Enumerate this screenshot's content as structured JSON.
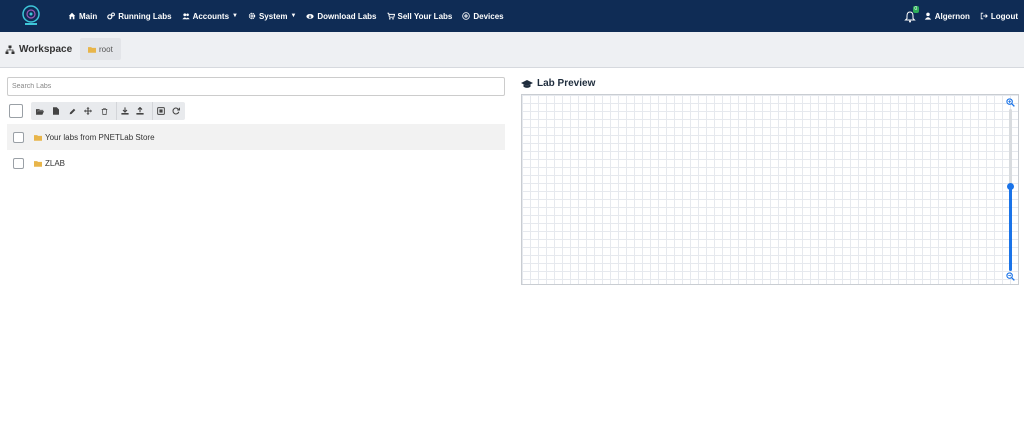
{
  "nav": {
    "items": [
      {
        "label": "Main",
        "icon": "home-icon"
      },
      {
        "label": "Running Labs",
        "icon": "cogs-icon"
      },
      {
        "label": "Accounts",
        "icon": "users-icon",
        "dropdown": true
      },
      {
        "label": "System",
        "icon": "gear-icon",
        "dropdown": true
      },
      {
        "label": "Download Labs",
        "icon": "cloud-download-icon"
      },
      {
        "label": "Sell Your Labs",
        "icon": "cart-icon"
      },
      {
        "label": "Devices",
        "icon": "plus-circle-icon"
      }
    ],
    "notification_count": "0",
    "user": "Algernon",
    "logout": "Logout"
  },
  "workspace": {
    "title": "Workspace",
    "breadcrumb": "root"
  },
  "left": {
    "search_placeholder": "Search Labs",
    "rows": [
      {
        "label": "Your labs from PNETLab Store"
      },
      {
        "label": "ZLAB"
      }
    ]
  },
  "preview": {
    "title": "Lab Preview",
    "zoom_level": 0.52
  },
  "colors": {
    "navbar": "#0f2c55",
    "folder": "#e8b54a",
    "accent": "#1a73e8",
    "badge": "#2eae5a"
  }
}
